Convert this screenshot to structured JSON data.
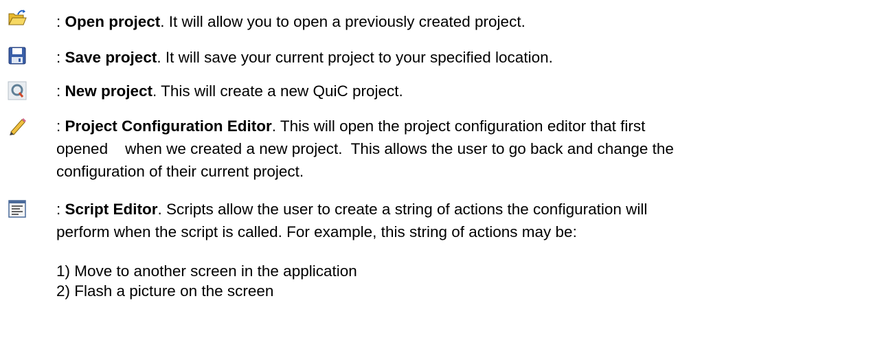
{
  "items": [
    {
      "icon": "open-folder-icon",
      "prefix": ": ",
      "name": "Open project",
      "desc": ".  It will allow you to open a previously created project."
    },
    {
      "icon": "floppy-disk-icon",
      "prefix": ": ",
      "name": "Save project",
      "desc": ".   It will save your current project to your specified location."
    },
    {
      "icon": "quic-logo-icon",
      "prefix": ": ",
      "name": "New project",
      "desc": ".  This will create a new QuiC project."
    },
    {
      "icon": "pencil-icon",
      "prefix": ": ",
      "name": "Project Configuration Editor",
      "desc": ".  This will open the project configuration editor that first",
      "line2": "opened    when we created a new project.  This allows the user to go back and change the",
      "line3": "configuration of their current project."
    },
    {
      "icon": "script-editor-icon",
      "prefix": ": ",
      "name": "Script Editor",
      "desc": ".  Scripts allow the user to create a string of actions the configuration will",
      "line2": "perform when the script is called.  For example, this string of actions may be:"
    }
  ],
  "list": [
    "1) Move to another screen in the application",
    "2) Flash a picture on the screen"
  ]
}
